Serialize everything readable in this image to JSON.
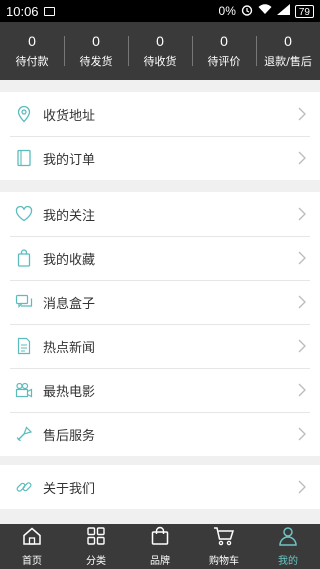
{
  "status_bar": {
    "time": "10:06",
    "signal_text": "0%",
    "battery": "79"
  },
  "orders": [
    {
      "count": "0",
      "label": "待付款"
    },
    {
      "count": "0",
      "label": "待发货"
    },
    {
      "count": "0",
      "label": "待收货"
    },
    {
      "count": "0",
      "label": "待评价"
    },
    {
      "count": "0",
      "label": "退款/售后"
    }
  ],
  "menu_group_1": [
    {
      "label": "收货地址",
      "icon": "location-pin-icon"
    },
    {
      "label": "我的订单",
      "icon": "order-book-icon"
    }
  ],
  "menu_group_2": [
    {
      "label": "我的关注",
      "icon": "heart-icon"
    },
    {
      "label": "我的收藏",
      "icon": "bag-icon"
    },
    {
      "label": "消息盒子",
      "icon": "message-icon"
    },
    {
      "label": "热点新闻",
      "icon": "news-icon"
    },
    {
      "label": "最热电影",
      "icon": "movie-camera-icon"
    },
    {
      "label": "售后服务",
      "icon": "tools-icon"
    }
  ],
  "menu_group_3": [
    {
      "label": "关于我们",
      "icon": "link-icon"
    }
  ],
  "bottom_nav": [
    {
      "label": "首页",
      "icon": "home-icon"
    },
    {
      "label": "分类",
      "icon": "grid-icon"
    },
    {
      "label": "品牌",
      "icon": "shopping-bag-icon"
    },
    {
      "label": "购物车",
      "icon": "cart-icon"
    },
    {
      "label": "我的",
      "icon": "user-icon",
      "active": true
    }
  ],
  "colors": {
    "accent": "#6cc5c4",
    "dark": "#3a3a3a",
    "icon": "#5bbcbc"
  }
}
